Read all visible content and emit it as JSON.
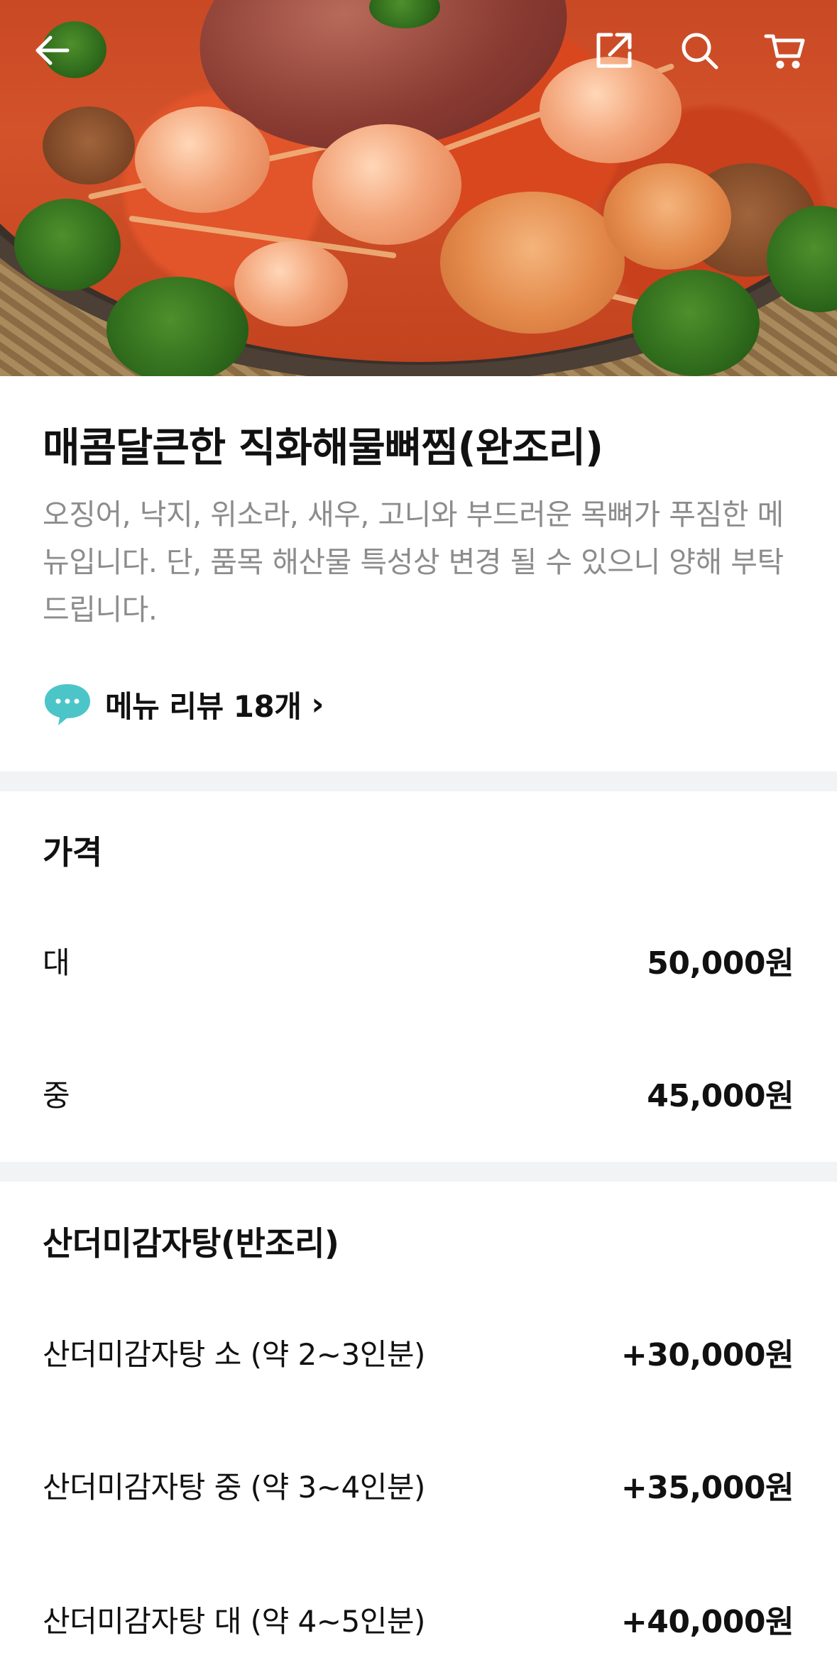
{
  "top_bar": {
    "back_icon": "arrow-left-icon",
    "share_icon": "share-icon",
    "search_icon": "search-icon",
    "cart_icon": "cart-icon",
    "icon_color": "#ffffff"
  },
  "menu": {
    "title": "매콤달큰한 직화해물뼈찜(완조리)",
    "description": "오징어, 낙지, 위소라, 새우, 고니와 부드러운 목뼈가 푸짐한 메뉴입니다. 단, 품목 해산물 특성상 변경 될 수 있으니 양해 부탁드립니다.",
    "review_link": "메뉴 리뷰 18개",
    "review_icon": "speech-bubble-icon",
    "review_chevron": "›"
  },
  "price_section": {
    "title": "가격",
    "options": [
      {
        "name": "대",
        "price": "50,000원"
      },
      {
        "name": "중",
        "price": "45,000원"
      }
    ]
  },
  "addon_section": {
    "title": "산더미감자탕(반조리)",
    "options": [
      {
        "name": "산더미감자탕 소 (약 2~3인분)",
        "price": "+30,000원"
      },
      {
        "name": "산더미감자탕 중 (약 3~4인분)",
        "price": "+35,000원"
      },
      {
        "name": "산더미감자탕 대 (약 4~5인분)",
        "price": "+40,000원"
      }
    ]
  },
  "colors": {
    "text_primary": "#111111",
    "text_secondary": "#8c8c8c",
    "divider": "#f2f3f5",
    "review_icon": "#4cc5c9"
  }
}
